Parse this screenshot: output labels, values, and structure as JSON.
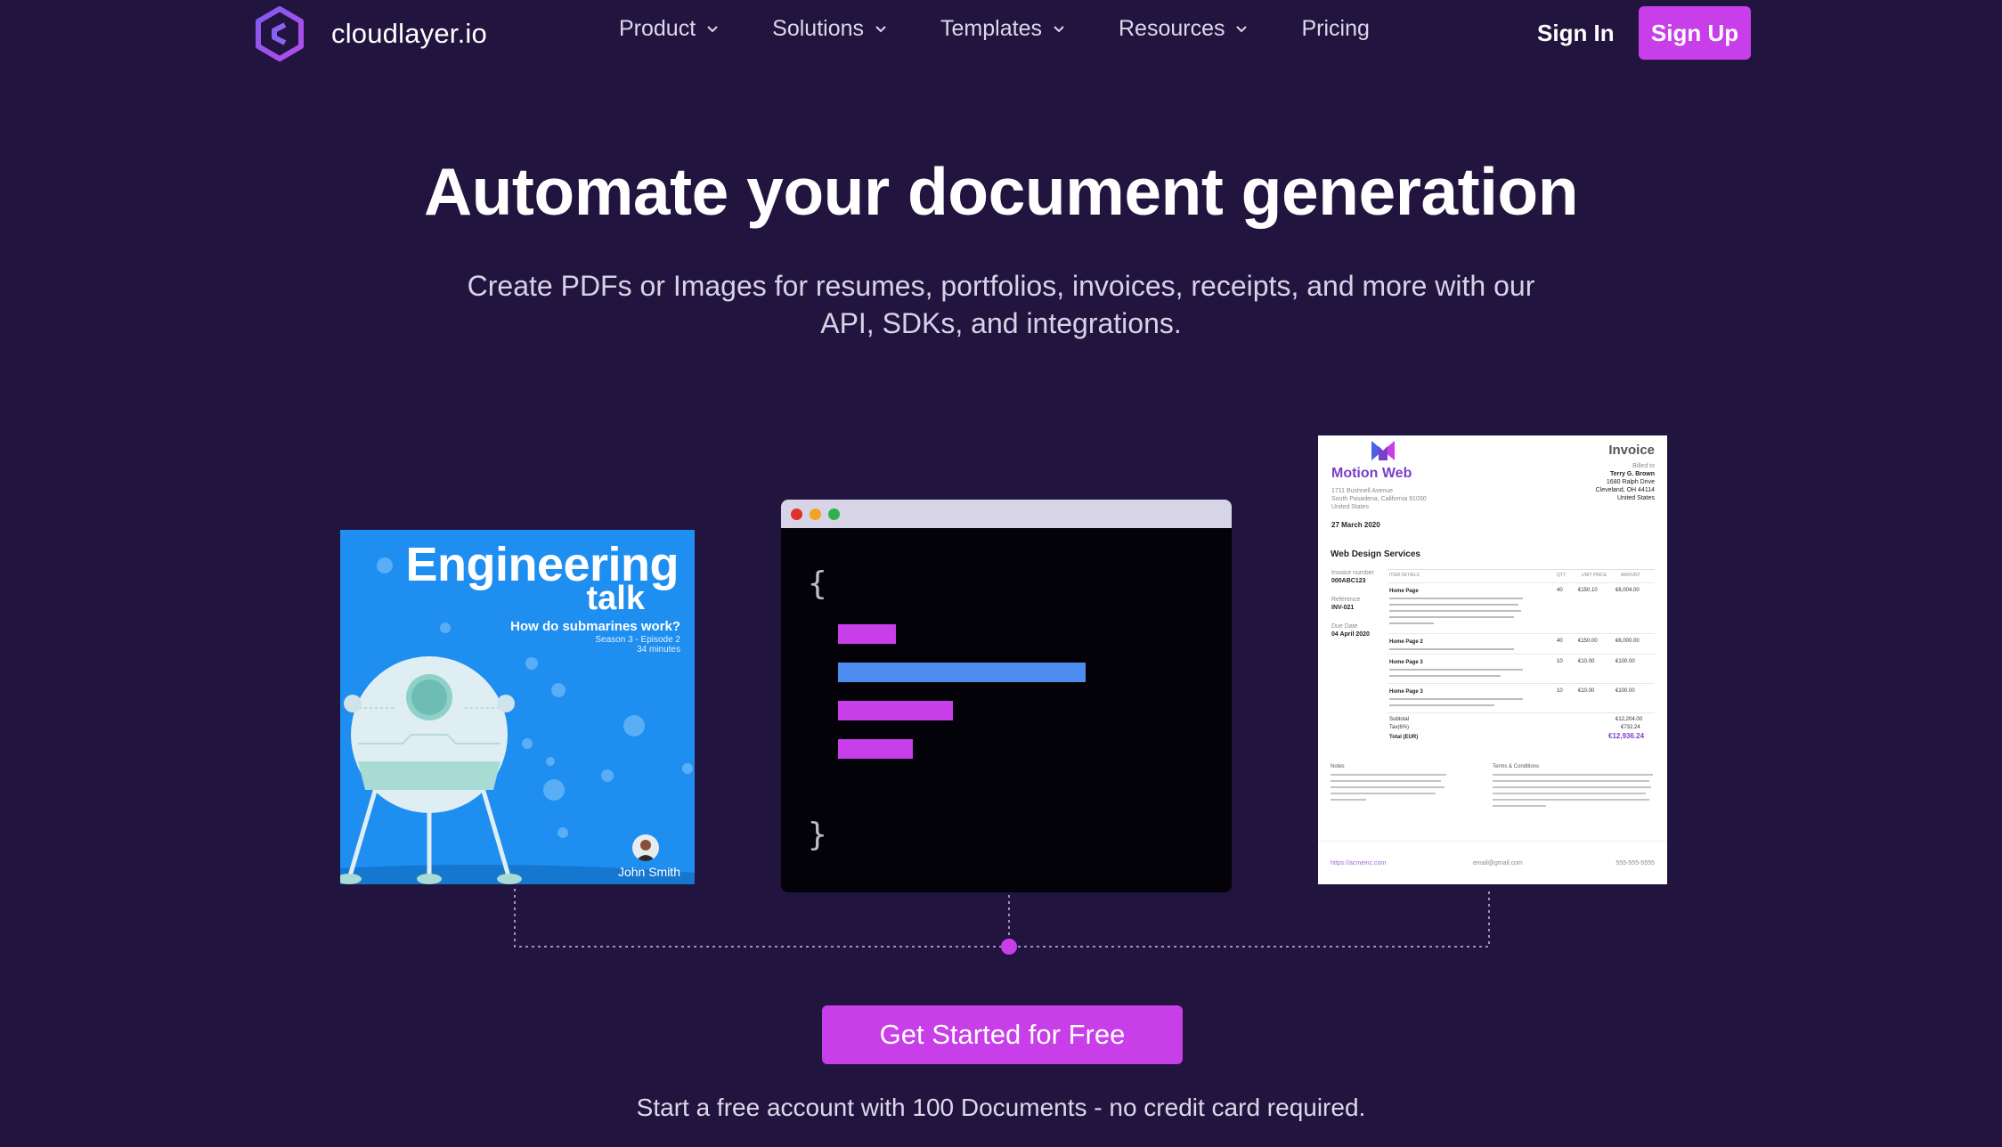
{
  "brand": {
    "name": "cloudlayer.io",
    "logo_icon": "cloudlayer-logo-icon",
    "accent": "#c83ee8",
    "background": "#21143f"
  },
  "nav": {
    "items": [
      {
        "label": "Product",
        "has_dropdown": true
      },
      {
        "label": "Solutions",
        "has_dropdown": true
      },
      {
        "label": "Templates",
        "has_dropdown": true
      },
      {
        "label": "Resources",
        "has_dropdown": true
      },
      {
        "label": "Pricing",
        "has_dropdown": false
      }
    ],
    "sign_in": "Sign In",
    "sign_up": "Sign Up"
  },
  "hero": {
    "title": "Automate your document generation",
    "subtitle": "Create PDFs or Images for resumes, portfolios, invoices, receipts, and more with our API, SDKs, and integrations."
  },
  "example_image": {
    "title": "Engineering",
    "title2": "talk",
    "question": "How do submarines work?",
    "episode": "Season 3 - Episode 2",
    "duration": "34 minutes",
    "author": "John Smith"
  },
  "code_window": {
    "open_brace": "{",
    "close_brace": "}"
  },
  "invoice": {
    "company": "Motion Web",
    "heading": "Invoice",
    "address1": "1711 Bushnell Avenue",
    "address2": "South Pasadena, California 91030",
    "country": "United States",
    "date": "27 March 2020",
    "billed_label": "Billed to",
    "billed_name": "Terry G. Brown",
    "billed_addr1": "1680 Ralph Drive",
    "billed_addr2": "Cleveland, OH 44114",
    "billed_country": "United States",
    "section": "Web Design Services",
    "invoice_number_label": "Invoice number",
    "invoice_number": "000ABC123",
    "reference_label": "Reference",
    "reference": "INV-021",
    "due_label": "Due Date",
    "due": "04 April 2020",
    "columns": [
      "ITEM DETAILS",
      "QTY",
      "UNIT PRICE",
      "AMOUNT"
    ],
    "rows": [
      {
        "item": "Home Page",
        "qty": "40",
        "price": "€150.10",
        "amount": "€6,004.00"
      },
      {
        "item": "Home Page 2",
        "qty": "40",
        "price": "€150.00",
        "amount": "€6,000.00"
      },
      {
        "item": "Home Page 3",
        "qty": "10",
        "price": "€10.00",
        "amount": "€100.00"
      },
      {
        "item": "Home Page 3",
        "qty": "10",
        "price": "€10.00",
        "amount": "€100.00"
      }
    ],
    "subtotal_label": "Subtotal",
    "subtotal": "€12,204.00",
    "tax_label": "Tax(6%)",
    "tax": "€732.24",
    "total_label": "Total (EUR)",
    "total": "€12,936.24",
    "notes_label": "Notes",
    "terms_label": "Terms & Conditions",
    "footer_url": "https://acmeinc.com",
    "footer_email": "email@gmail.com",
    "footer_phone": "555-555-5555"
  },
  "cta": {
    "button": "Get Started for Free",
    "note": "Start a free account with 100 Documents - no credit card required."
  }
}
